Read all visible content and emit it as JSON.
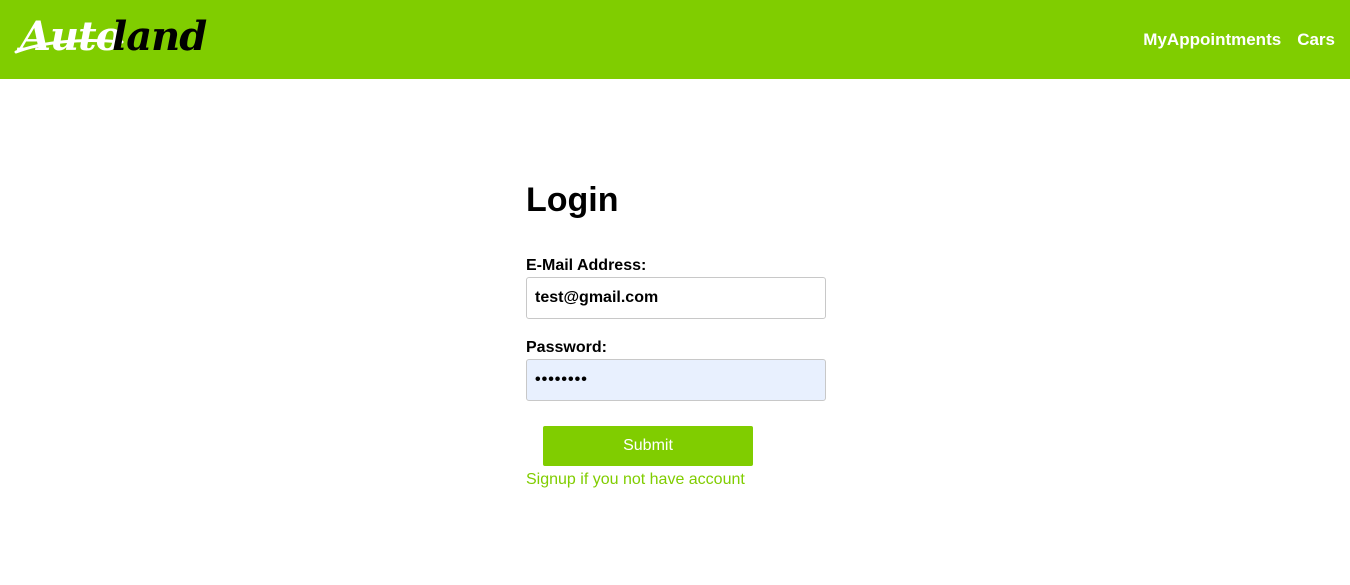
{
  "brand": {
    "logo_text_part1": "Auto",
    "logo_text_part2": "land",
    "color_primary": "#80cd00",
    "color_logo_part1": "#ffffff",
    "color_logo_part2": "#000000"
  },
  "nav": {
    "items": [
      {
        "label": "MyAppointments"
      },
      {
        "label": "Cars"
      }
    ]
  },
  "login": {
    "title": "Login",
    "email_label": "E-Mail Address:",
    "email_value": "test@gmail.com",
    "password_label": "Password:",
    "password_value": "••••••••",
    "submit_label": "Submit",
    "signup_link": "Signup if you not have account"
  }
}
